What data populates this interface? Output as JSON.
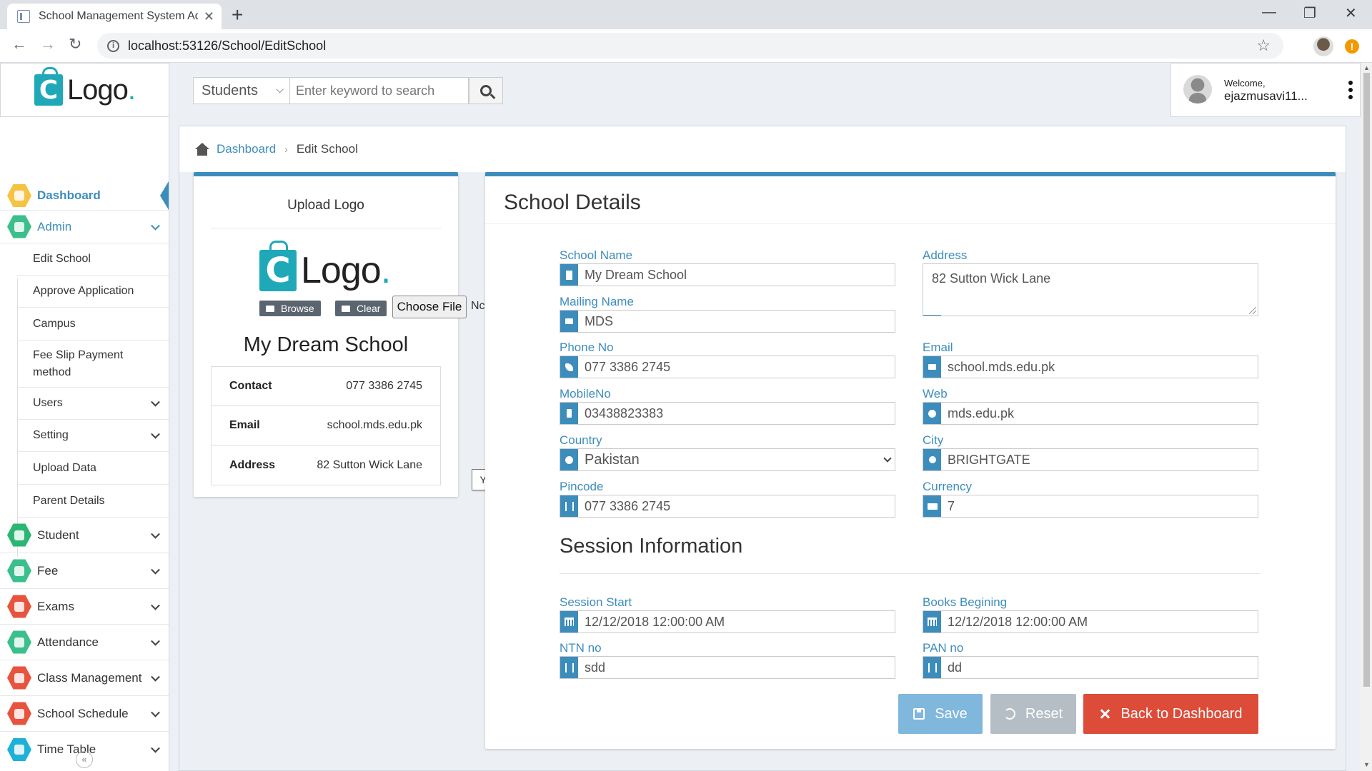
{
  "browser": {
    "tab_title": "School Management System Adr",
    "url": "localhost:53126/School/EditSchool"
  },
  "header": {
    "logo_letter": "C",
    "logo_text": "Logo",
    "logo_dot": ".",
    "search_category": "Students",
    "search_placeholder": "Enter keyword to search",
    "welcome": "Welcome,",
    "username": "ejazmusavi11..."
  },
  "sidebar": {
    "items": [
      {
        "label": "Dashboard",
        "color": "#f5c242",
        "active": true
      },
      {
        "label": "Admin",
        "color": "#3bbf8c",
        "expanded": true
      },
      {
        "label": "Student",
        "color": "#2bb673"
      },
      {
        "label": "Fee",
        "color": "#3bbf8c"
      },
      {
        "label": "Exams",
        "color": "#e8533e"
      },
      {
        "label": "Attendance",
        "color": "#3bbf8c"
      },
      {
        "label": "Class Management",
        "color": "#e8533e"
      },
      {
        "label": "School Schedule",
        "color": "#e8533e"
      },
      {
        "label": "Time Table",
        "color": "#1fb0d8"
      }
    ],
    "admin_sub": [
      {
        "label": "Edit School"
      },
      {
        "label": "Approve Application"
      },
      {
        "label": "Campus"
      },
      {
        "label": "Fee Slip Payment method"
      },
      {
        "label": "Users"
      },
      {
        "label": "Setting"
      },
      {
        "label": "Upload Data"
      },
      {
        "label": "Parent Details"
      }
    ],
    "collapse_glyph": "«"
  },
  "breadcrumb": {
    "home": "Dashboard",
    "separator": "›",
    "current": "Edit School"
  },
  "upload": {
    "title": "Upload Logo",
    "browse_label": "Browse",
    "clear_label": "Clear",
    "choose_file_label": "Choose File",
    "no_file_text": "Nc",
    "school_name": "My Dream School",
    "info": [
      {
        "key": "Contact",
        "value": "077 3386 2745"
      },
      {
        "key": "Email",
        "value": "school.mds.edu.pk"
      },
      {
        "key": "Address",
        "value": "82 Sutton Wick Lane"
      }
    ],
    "tooltip": "YouTube"
  },
  "details": {
    "title": "School Details",
    "fields": {
      "school_name": {
        "label": "School Name",
        "value": "My Dream School"
      },
      "mailing_name": {
        "label": "Mailing Name",
        "value": "MDS"
      },
      "phone": {
        "label": "Phone No",
        "value": "077 3386 2745"
      },
      "mobile": {
        "label": "MobileNo",
        "value": "03438823383"
      },
      "country": {
        "label": "Country",
        "value": "Pakistan"
      },
      "pincode": {
        "label": "Pincode",
        "value": "077 3386 2745"
      },
      "address": {
        "label": "Address",
        "value": "82  Sutton Wick Lane"
      },
      "email": {
        "label": "Email",
        "value": "school.mds.edu.pk"
      },
      "web": {
        "label": "Web",
        "value": "mds.edu.pk"
      },
      "city": {
        "label": "City",
        "value": "BRIGHTGATE"
      },
      "currency": {
        "label": "Currency",
        "value": "7"
      }
    },
    "session_title": "Session Information",
    "session": {
      "start": {
        "label": "Session Start",
        "value": "12/12/2018 12:00:00 AM"
      },
      "books": {
        "label": "Books Begining",
        "value": "12/12/2018 12:00:00 AM"
      },
      "ntn": {
        "label": "NTN no",
        "value": "sdd"
      },
      "pan": {
        "label": "PAN no",
        "value": "dd"
      }
    },
    "buttons": {
      "save": "Save",
      "reset": "Reset",
      "back": "Back to Dashboard"
    }
  }
}
